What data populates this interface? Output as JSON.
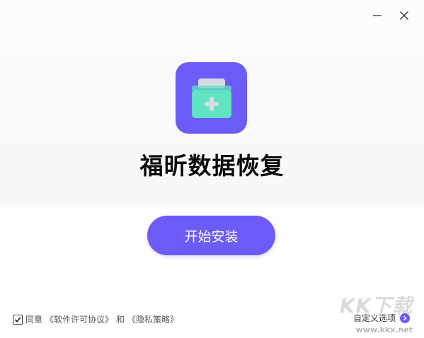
{
  "window": {
    "minimize_label": "–",
    "close_label": "✕"
  },
  "app": {
    "icon_name": "first-aid-kit-icon",
    "title": "福昕数据恢复"
  },
  "install_button": {
    "label": "开始安装"
  },
  "agreement": {
    "checked": true,
    "prefix": "同意",
    "license_link": "《软件许可协议》",
    "conjunction": "和",
    "privacy_link": "《隐私策略》"
  },
  "custom_options": {
    "label": "自定义选项"
  },
  "watermark": {
    "logo_text": "KK下载",
    "url": "www.kkx.net"
  },
  "colors": {
    "accent": "#6c5bf6",
    "kit_body": "#5fe3c0",
    "kit_lid": "#d8dbe6"
  }
}
